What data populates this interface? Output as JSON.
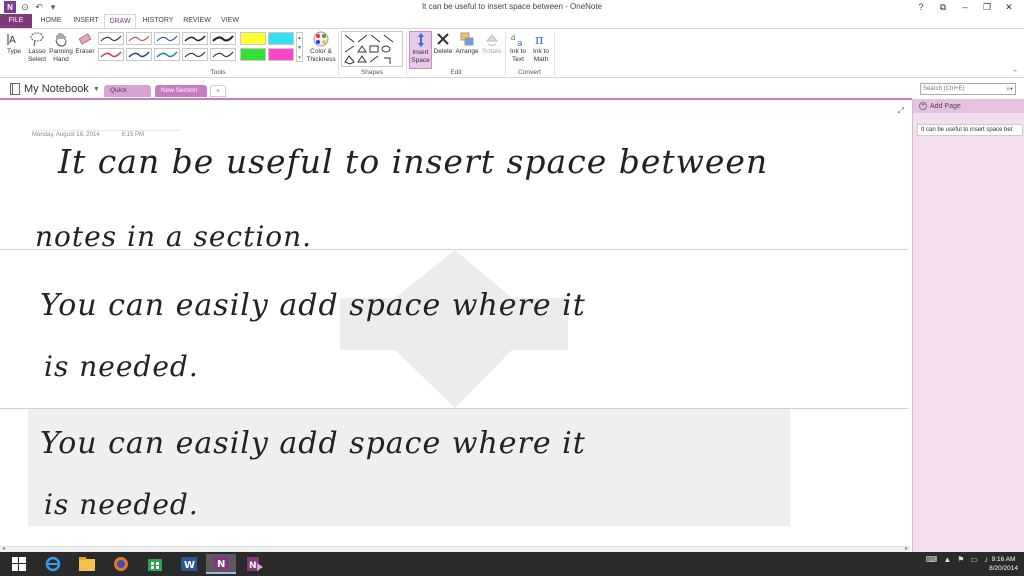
{
  "window": {
    "title": "It can be useful to insert space between - OneNote",
    "controls": [
      "?",
      "⧉",
      "–",
      "❐",
      "✕"
    ]
  },
  "quick_access": {
    "app_icon": "onenote-logo",
    "logo_text": "N",
    "back": "back-icon",
    "undo": "↶"
  },
  "tabs": [
    {
      "label": "FILE"
    },
    {
      "label": "HOME"
    },
    {
      "label": "INSERT"
    },
    {
      "label": "DRAW"
    },
    {
      "label": "HISTORY"
    },
    {
      "label": "REVIEW"
    },
    {
      "label": "VIEW"
    }
  ],
  "ribbon": {
    "type": "Type",
    "lasso": "Lasso Select",
    "panning": "Panning Hand",
    "eraser": "Eraser",
    "color_thickness": "Color & Thickness",
    "tools_label": "Tools",
    "shapes_label": "Shapes",
    "insert_space": "Insert Space",
    "delete": "Delete",
    "arrange": "Arrange",
    "rotate": "Rotate",
    "edit_label": "Edit",
    "ink_to_text": "Ink to Text",
    "ink_to_math": "Ink to Math",
    "convert_label": "Convert",
    "pens": [
      {
        "color": "#222222"
      },
      {
        "color": "#d33a3a"
      },
      {
        "color": "#2a3fa0"
      },
      {
        "color": "#222222"
      },
      {
        "color": "#222222"
      },
      {
        "color": "#d33a3a"
      },
      {
        "color": "#2a3fa0"
      },
      {
        "color": "#1d8a8a"
      },
      {
        "color": "#222222"
      },
      {
        "color": "#222222"
      }
    ],
    "highlighters": [
      "#ffff33",
      "#33e0f0",
      "#33e033",
      "#ff44cc"
    ]
  },
  "notebook": {
    "name": "My Notebook",
    "sections": [
      {
        "label": "Quick Notes"
      },
      {
        "label": "New Section 1"
      },
      {
        "label": "+"
      }
    ],
    "search_placeholder": "Search (Ctrl+E)"
  },
  "page": {
    "date": "Monday, August 18, 2014",
    "time": "8:15 PM",
    "ink_lines": [
      "It can be  useful to insert space between",
      "notes in a section.",
      "You can easily add space where it",
      "is needed.",
      "You can easily add space where it",
      "is needed."
    ]
  },
  "panel": {
    "add_page": "Add Page",
    "pages": [
      "It can be useful to insert space bet"
    ]
  },
  "taskbar": {
    "time": "9:16 AM",
    "date": "8/20/2014"
  }
}
